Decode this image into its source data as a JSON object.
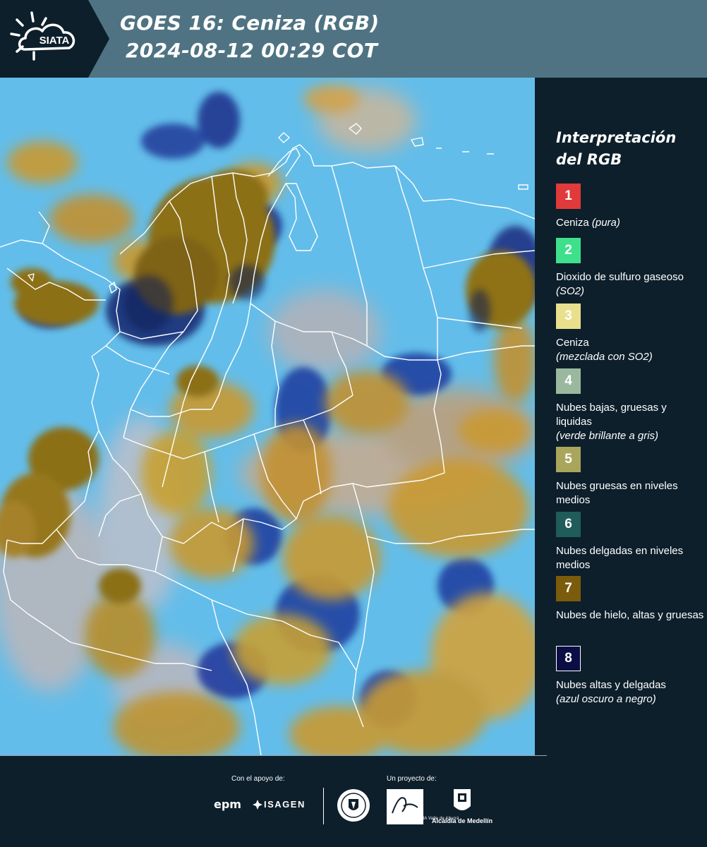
{
  "header": {
    "logo_text": "SIATA",
    "title_line1": "GOES 16: Ceniza (RGB)",
    "title_line2": "2024-08-12 00:29 COT"
  },
  "map": {
    "description_colors": {
      "background_sky": "#57b7e8",
      "ice_clouds": "#8c6f16",
      "mid_clouds": "#c99a30",
      "thin_high_clouds": "#1c2e8a",
      "boundary_lines": "#ffffff"
    }
  },
  "legend": {
    "title": "Interpretación del RGB",
    "items": [
      {
        "number": "1",
        "label": "Ceniza",
        "note": "(pura)",
        "color": "#e03a3a"
      },
      {
        "number": "2",
        "label": "Dioxido de sulfuro gaseoso",
        "note": "(SO2)",
        "color": "#3fe08c"
      },
      {
        "number": "3",
        "label": "Ceniza",
        "note": "(mezclada con SO2)",
        "color": "#e8e08c"
      },
      {
        "number": "4",
        "label": "Nubes bajas, gruesas y liquidas",
        "note": "(verde brillante a gris)",
        "color": "#9ab89e"
      },
      {
        "number": "5",
        "label": "Nubes gruesas en niveles medios",
        "note": "",
        "color": "#a9a65c"
      },
      {
        "number": "6",
        "label": "Nubes delgadas en niveles medios",
        "note": "",
        "color": "#1f5c5a"
      },
      {
        "number": "7",
        "label": "Nubes de hielo, altas y gruesas",
        "note": "",
        "color": "#7a5c0c"
      },
      {
        "number": "8",
        "label": "Nubes altas y delgadas",
        "note": "(azul oscuro a negro)",
        "color": "#0a0e44"
      }
    ]
  },
  "footer": {
    "support_label": "Con el apoyo de:",
    "project_label": "Un proyecto de:",
    "epm": "epm",
    "isagen": "ISAGEN",
    "metro_label": "METROPOLITANA Valle de Aburrá",
    "alcaldia": "Alcaldía de Medellín"
  }
}
